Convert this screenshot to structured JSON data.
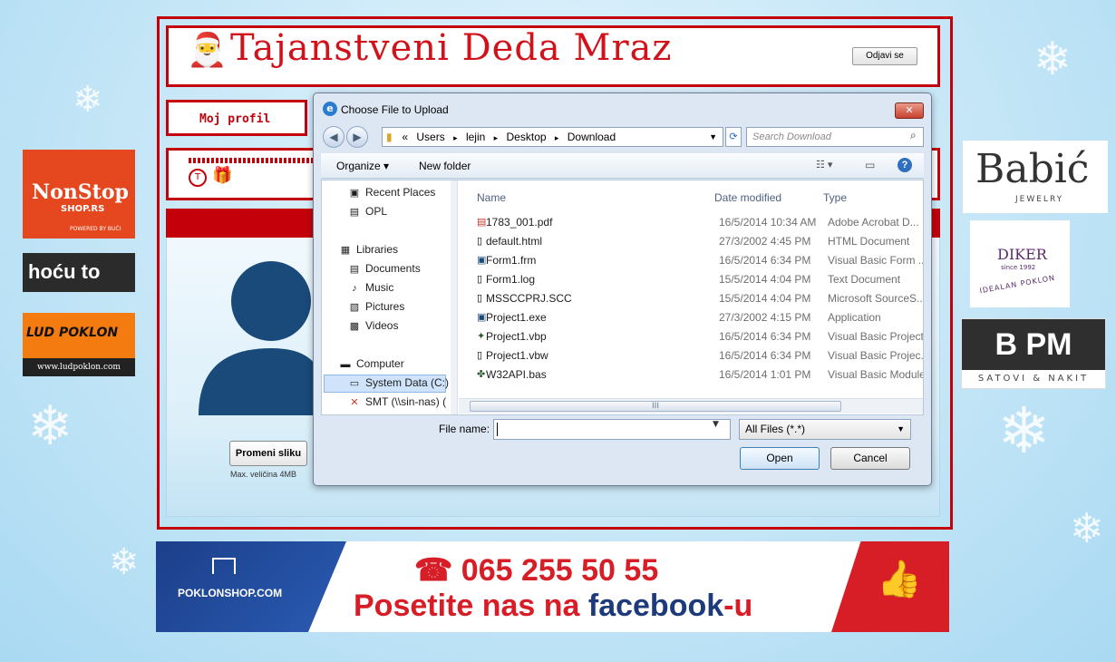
{
  "header": {
    "title": "Tajanstveni Deda Mraz",
    "logout_label": "Odjavi se"
  },
  "profile": {
    "link_label": "Moj profil",
    "strip_icons": [
      "T",
      "gift"
    ]
  },
  "avatar": {
    "change_button": "Promeni sliku",
    "max_size": "Max. veličina 4MB"
  },
  "ads": {
    "left": [
      {
        "name": "NonStop",
        "sub": "SHOP.RS",
        "powered": "POWERED BY BUĆI"
      },
      {
        "name": "hoću to"
      },
      {
        "name": "LUD POKLON",
        "sub": "www.ludpoklon.com"
      }
    ],
    "right": [
      {
        "name": "Babić",
        "sub": "JEWELRY"
      },
      {
        "name": "DIKER",
        "mid": "since 1992",
        "sub": "IDEALAN POKLON"
      },
      {
        "name": "B PM",
        "sub": "SATOVI & NAKIT"
      }
    ]
  },
  "banner": {
    "shop": "POKLONSHOP.COM",
    "phone": "☎ 065 255 50 55",
    "line2_prefix": "Posetite nas na ",
    "line2_brand": "facebook",
    "line2_suffix": "-u"
  },
  "dialog": {
    "title": "Choose File to Upload",
    "close_label": "✕",
    "breadcrumb": [
      "«",
      "Users",
      "lejin",
      "Desktop",
      "Download"
    ],
    "search_placeholder": "Search Download",
    "toolbar": {
      "organize": "Organize ▾",
      "new_folder": "New folder"
    },
    "nav_items": [
      {
        "label": "Recent Places",
        "icon": "recent-places-icon"
      },
      {
        "label": "OPL",
        "icon": "folder-icon"
      },
      {
        "label": "Libraries",
        "icon": "library-icon"
      },
      {
        "label": "Documents",
        "icon": "documents-icon"
      },
      {
        "label": "Music",
        "icon": "music-icon"
      },
      {
        "label": "Pictures",
        "icon": "pictures-icon"
      },
      {
        "label": "Videos",
        "icon": "videos-icon"
      },
      {
        "label": "Computer",
        "icon": "computer-icon"
      },
      {
        "label": "System Data (C:)",
        "icon": "drive-icon"
      },
      {
        "label": "SMT (\\\\sin-nas) (",
        "icon": "network-drive-icon"
      }
    ],
    "columns": [
      "Name",
      "Date modified",
      "Type"
    ],
    "files": [
      {
        "name": "1783_001.pdf",
        "date": "16/5/2014 10:34 AM",
        "type": "Adobe Acrobat D...",
        "icon": "pdf-icon"
      },
      {
        "name": "default.html",
        "date": "27/3/2002 4:45 PM",
        "type": "HTML Document",
        "icon": "file-icon"
      },
      {
        "name": "Form1.frm",
        "date": "16/5/2014 6:34 PM",
        "type": "Visual Basic Form ...",
        "icon": "vb-form-icon"
      },
      {
        "name": "Form1.log",
        "date": "15/5/2014 4:04 PM",
        "type": "Text Document",
        "icon": "file-icon"
      },
      {
        "name": "MSSCCPRJ.SCC",
        "date": "15/5/2014 4:04 PM",
        "type": "Microsoft SourceS...",
        "icon": "file-icon"
      },
      {
        "name": "Project1.exe",
        "date": "27/3/2002 4:15 PM",
        "type": "Application",
        "icon": "exe-icon"
      },
      {
        "name": "Project1.vbp",
        "date": "16/5/2014 6:34 PM",
        "type": "Visual Basic Project",
        "icon": "vb-project-icon"
      },
      {
        "name": "Project1.vbw",
        "date": "16/5/2014 6:34 PM",
        "type": "Visual Basic Projec...",
        "icon": "file-icon"
      },
      {
        "name": "W32API.bas",
        "date": "16/5/2014 1:01 PM",
        "type": "Visual Basic Module",
        "icon": "vb-module-icon"
      }
    ],
    "scroll_grip": "III",
    "file_name_label": "File name:",
    "file_name_value": "",
    "file_type": "All Files (*.*)",
    "open_label": "Open",
    "cancel_label": "Cancel"
  },
  "colors": {
    "frame_red": "#c4000b",
    "banner_blue": "#1d3a7a",
    "banner_red": "#d71e27"
  }
}
